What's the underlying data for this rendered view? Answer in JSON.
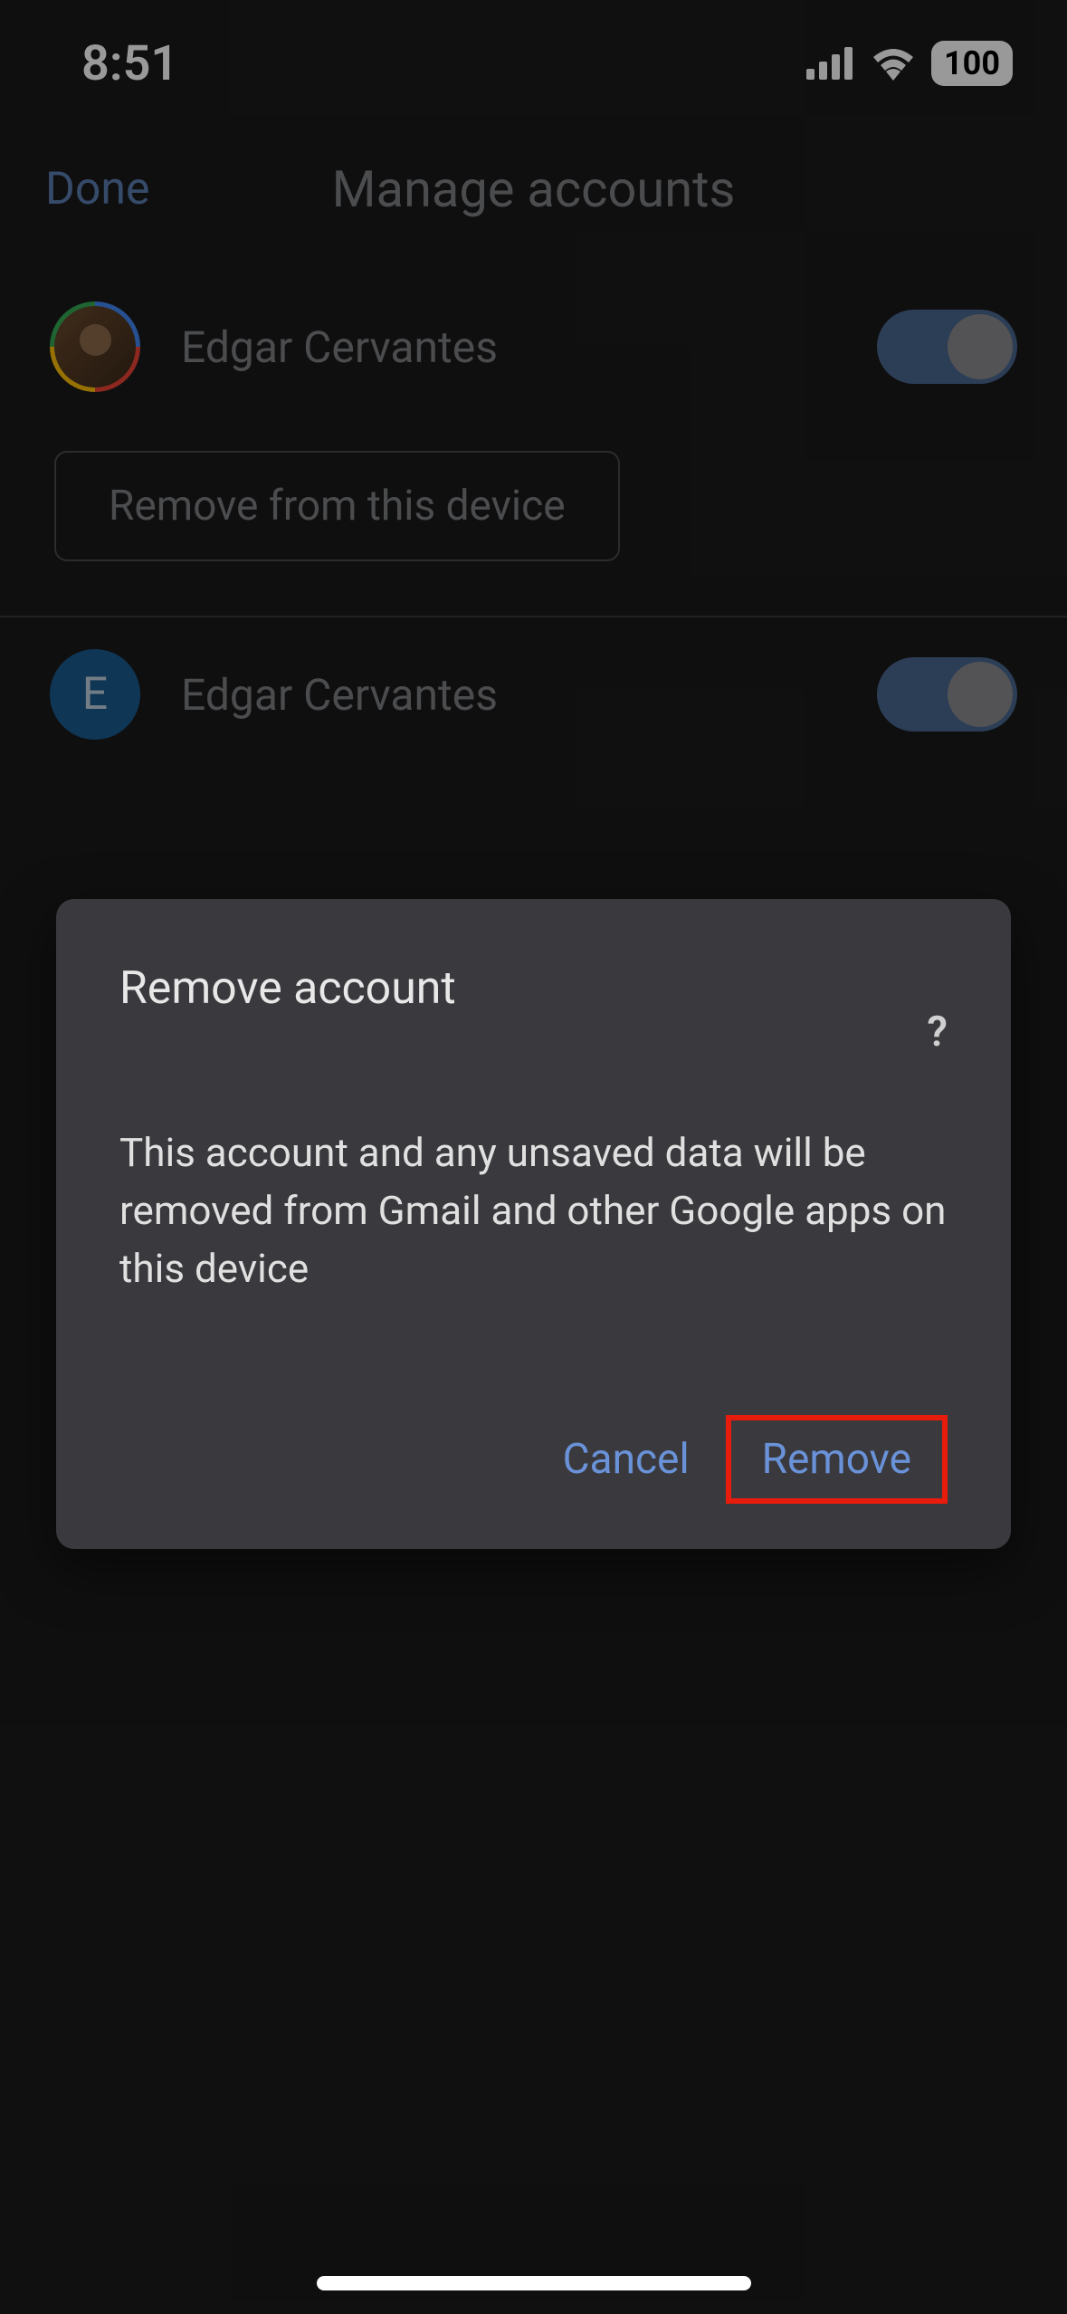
{
  "status": {
    "time": "8:51",
    "battery": "100"
  },
  "header": {
    "done": "Done",
    "title": "Manage accounts"
  },
  "accounts": [
    {
      "name": "Edgar Cervantes",
      "avatar_type": "photo",
      "toggle": true,
      "remove_label": "Remove from this device"
    },
    {
      "name": "Edgar Cervantes",
      "avatar_type": "letter",
      "avatar_letter": "E",
      "toggle": true
    }
  ],
  "dialog": {
    "title": "Remove account",
    "help": "?",
    "body": "This account and any unsaved data will be removed from Gmail and other Google apps on this device",
    "cancel": "Cancel",
    "remove": "Remove"
  }
}
